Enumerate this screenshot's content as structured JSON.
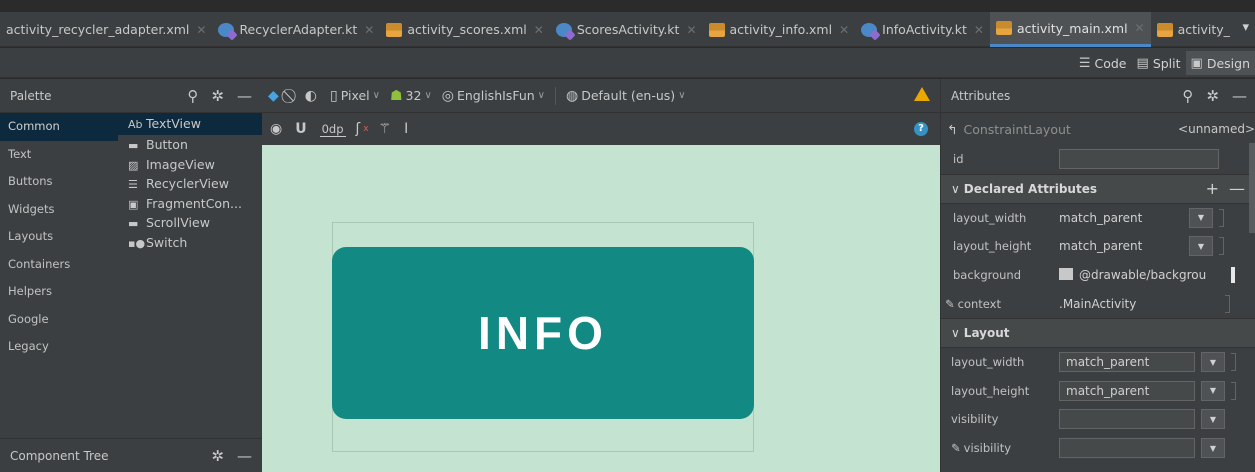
{
  "tabs": [
    {
      "label": "activity_recycler_adapter.xml",
      "type": "xml",
      "active": false
    },
    {
      "label": "RecyclerAdapter.kt",
      "type": "kt",
      "active": false
    },
    {
      "label": "activity_scores.xml",
      "type": "xml",
      "active": false
    },
    {
      "label": "ScoresActivity.kt",
      "type": "kt",
      "active": false
    },
    {
      "label": "activity_info.xml",
      "type": "xml",
      "active": false
    },
    {
      "label": "InfoActivity.kt",
      "type": "kt",
      "active": false
    },
    {
      "label": "activity_main.xml",
      "type": "xml",
      "active": true
    },
    {
      "label": "activity_",
      "type": "xml",
      "active": false
    }
  ],
  "view_modes": {
    "code": "Code",
    "split": "Split",
    "design": "Design",
    "active": "design"
  },
  "palette": {
    "title": "Palette",
    "categories": [
      "Common",
      "Text",
      "Buttons",
      "Widgets",
      "Layouts",
      "Containers",
      "Helpers",
      "Google",
      "Legacy"
    ],
    "active_category": "Common",
    "widgets": [
      {
        "icon": "Ab",
        "label": "TextView"
      },
      {
        "icon": "button-icon",
        "label": "Button"
      },
      {
        "icon": "image-icon",
        "label": "ImageView"
      },
      {
        "icon": "list-icon",
        "label": "RecyclerView"
      },
      {
        "icon": "fragment-icon",
        "label": "FragmentCon..."
      },
      {
        "icon": "scroll-icon",
        "label": "ScrollView"
      },
      {
        "icon": "switch-icon",
        "label": "Switch"
      }
    ]
  },
  "component_tree": {
    "title": "Component Tree"
  },
  "toolbar": {
    "device": "Pixel",
    "api": "32",
    "theme": "EnglishIsFun",
    "locale": "Default (en-us)",
    "margin": "0dp"
  },
  "canvas": {
    "button_text": "INFO",
    "background_color": "#c4e4d1",
    "button_color": "#128a83"
  },
  "attributes": {
    "title": "Attributes",
    "component": "ConstraintLayout",
    "unnamed": "<unnamed>",
    "id_label": "id",
    "id_value": "",
    "declared_title": "Declared Attributes",
    "declared": [
      {
        "name": "layout_width",
        "value": "match_parent"
      },
      {
        "name": "layout_height",
        "value": "match_parent"
      },
      {
        "name": "background",
        "value": "@drawable/backgrou"
      },
      {
        "name": "context",
        "value": ".MainActivity"
      }
    ],
    "layout_title": "Layout",
    "layout": [
      {
        "name": "layout_width",
        "value": "match_parent"
      },
      {
        "name": "layout_height",
        "value": "match_parent"
      },
      {
        "name": "visibility",
        "value": ""
      },
      {
        "name": "visibility",
        "value": ""
      }
    ]
  }
}
